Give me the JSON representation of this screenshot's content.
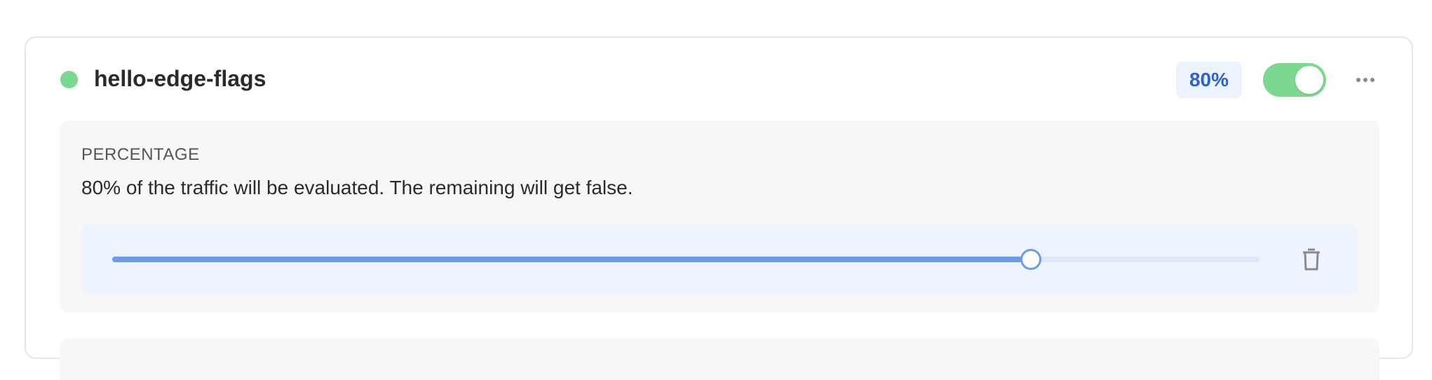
{
  "flag": {
    "name": "hello-edge-flags",
    "percentage_badge": "80%",
    "enabled": true
  },
  "rule": {
    "label": "PERCENTAGE",
    "description": "80% of the traffic will be evaluated. The remaining will get false.",
    "slider_value_percent": 80
  },
  "icons": {
    "status": "status-dot-icon",
    "more": "more-horizontal-icon",
    "delete": "trash-icon"
  },
  "colors": {
    "status_green": "#7bd88f",
    "toggle_on": "#7bd88f",
    "badge_bg": "#ecf3fd",
    "badge_text": "#2f62c9",
    "slider_fill": "#6c9ce9",
    "slider_box_bg": "#eef4fd",
    "trash_gray": "#8a8a8a"
  }
}
